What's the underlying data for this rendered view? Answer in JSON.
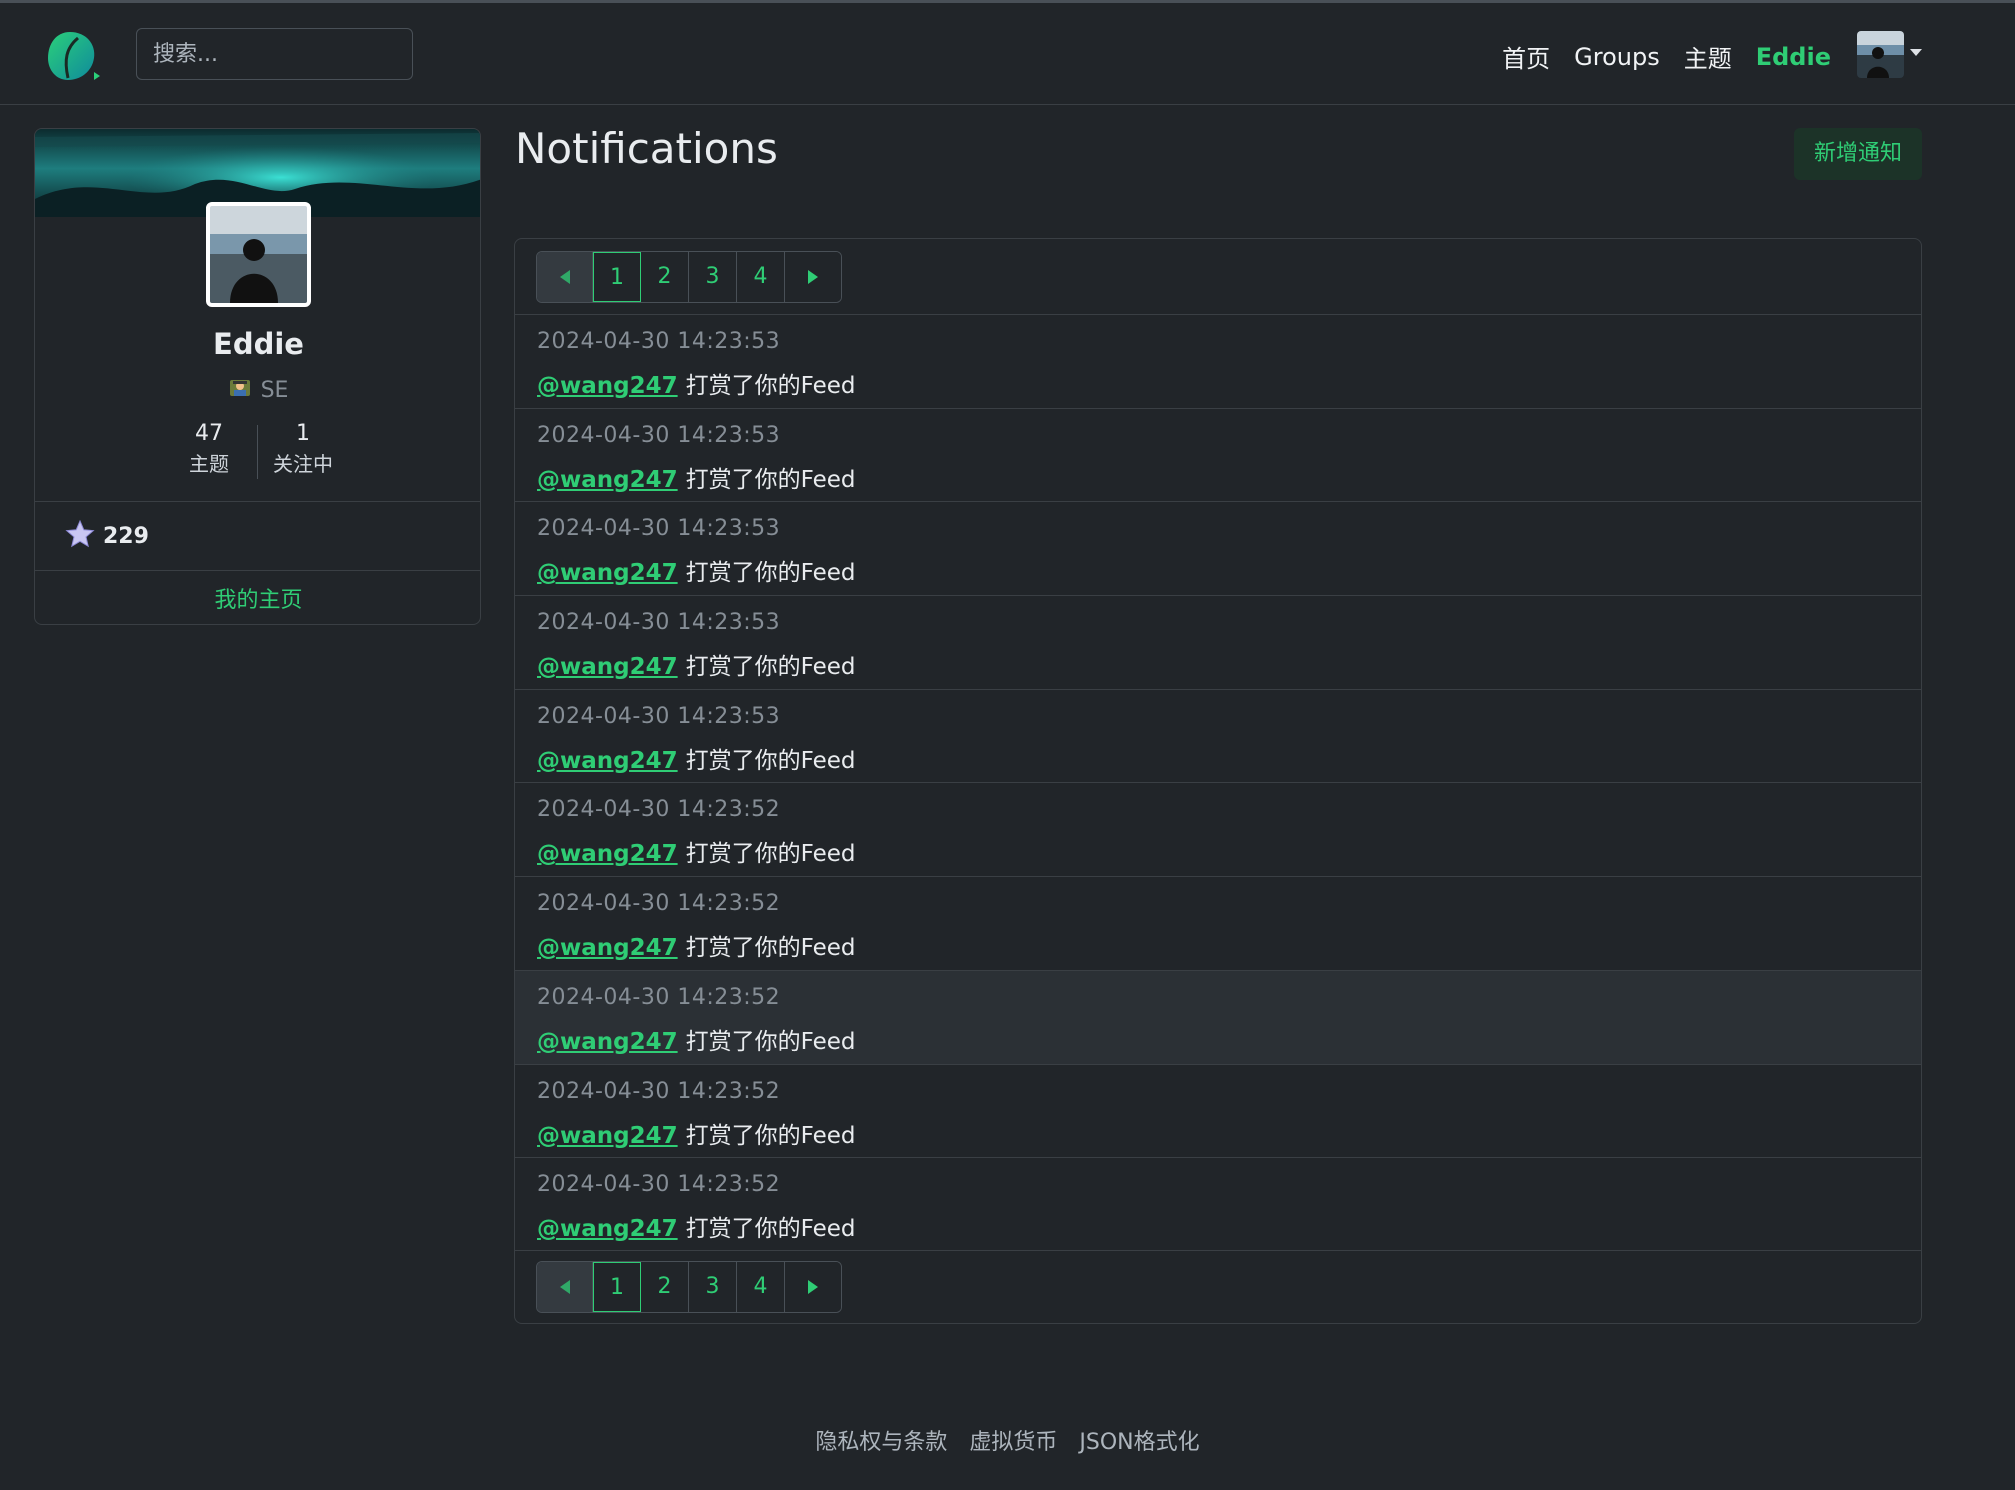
{
  "navbar": {
    "search_placeholder": "搜索...",
    "links": [
      "首页",
      "Groups",
      "主题"
    ],
    "user_name": "Eddie"
  },
  "profile": {
    "name": "Eddie",
    "role": "SE",
    "stats": [
      {
        "value": "47",
        "label": "主题"
      },
      {
        "value": "1",
        "label": "关注中"
      }
    ],
    "points": "229",
    "home_link": "我的主页"
  },
  "main": {
    "title": "Notifications",
    "new_button": "新增通知"
  },
  "pagination": {
    "pages": [
      "1",
      "2",
      "3",
      "4"
    ],
    "current": "1"
  },
  "notifications": [
    {
      "time": "2024-04-30 14:23:53",
      "user": "@wang247",
      "text": "打赏了你的Feed"
    },
    {
      "time": "2024-04-30 14:23:53",
      "user": "@wang247",
      "text": "打赏了你的Feed"
    },
    {
      "time": "2024-04-30 14:23:53",
      "user": "@wang247",
      "text": "打赏了你的Feed"
    },
    {
      "time": "2024-04-30 14:23:53",
      "user": "@wang247",
      "text": "打赏了你的Feed"
    },
    {
      "time": "2024-04-30 14:23:53",
      "user": "@wang247",
      "text": "打赏了你的Feed"
    },
    {
      "time": "2024-04-30 14:23:52",
      "user": "@wang247",
      "text": "打赏了你的Feed"
    },
    {
      "time": "2024-04-30 14:23:52",
      "user": "@wang247",
      "text": "打赏了你的Feed"
    },
    {
      "time": "2024-04-30 14:23:52",
      "user": "@wang247",
      "text": "打赏了你的Feed"
    },
    {
      "time": "2024-04-30 14:23:52",
      "user": "@wang247",
      "text": "打赏了你的Feed"
    },
    {
      "time": "2024-04-30 14:23:52",
      "user": "@wang247",
      "text": "打赏了你的Feed"
    }
  ],
  "footer": {
    "links": [
      "隐私权与条款",
      "虚拟货币",
      "JSON格式化"
    ]
  },
  "colors": {
    "background": "#212529",
    "accent": "#2fcd75",
    "muted": "#868e96",
    "border": "#3a3f44"
  },
  "icons": {
    "logo": "leaf-logo-icon",
    "prev": "caret-left-icon",
    "next": "caret-right-icon",
    "points": "star-icon",
    "role": "role-badge-icon",
    "user_menu": "chevron-down-icon"
  }
}
